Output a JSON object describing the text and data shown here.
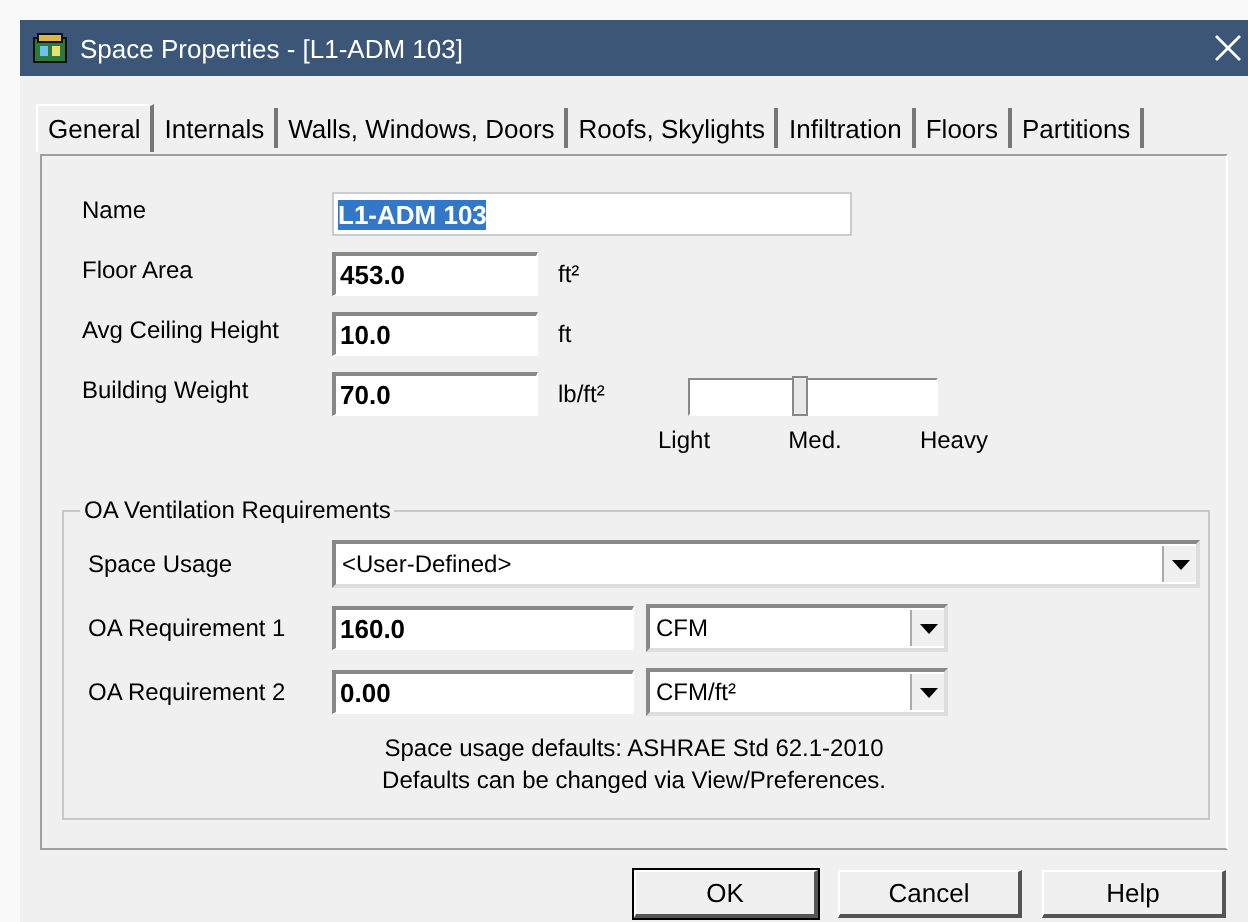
{
  "window": {
    "title": "Space Properties - [L1-ADM 103]"
  },
  "tabs": [
    {
      "label": "General",
      "selected": true
    },
    {
      "label": "Internals",
      "selected": false
    },
    {
      "label": "Walls, Windows, Doors",
      "selected": false
    },
    {
      "label": "Roofs, Skylights",
      "selected": false
    },
    {
      "label": "Infiltration",
      "selected": false
    },
    {
      "label": "Floors",
      "selected": false
    },
    {
      "label": "Partitions",
      "selected": false
    }
  ],
  "fields": [
    {
      "label": "Name",
      "value": "L1-ADM 103",
      "text_selected": true
    },
    {
      "label": "Floor Area",
      "value": "453.0",
      "unit": "ft²",
      "text_selected": false
    },
    {
      "label": "Avg Ceiling Height",
      "value": "10.0",
      "unit": "ft",
      "text_selected": false
    },
    {
      "label": "Building Weight",
      "value": "70.0",
      "unit": "lb/ft²",
      "text_selected": false
    }
  ],
  "weight_slider": {
    "level": 0.45,
    "labels": [
      "Light",
      "Med.",
      "Heavy"
    ]
  },
  "oa_ventilation": {
    "title": "OA Ventilation Requirements",
    "space_usage": {
      "label": "Space Usage",
      "value": "<User-Defined>"
    },
    "requirements": [
      {
        "label": "OA Requirement 1",
        "value": "160.0",
        "unit": "CFM"
      },
      {
        "label": "OA Requirement 2",
        "value": "0.00",
        "unit": "CFM/ft²"
      }
    ],
    "notes": [
      "Space usage defaults: ASHRAE Std 62.1-2010",
      "Defaults can be changed via View/Preferences."
    ]
  },
  "buttons": [
    {
      "label": "OK",
      "default": true
    },
    {
      "label": "Cancel",
      "default": false
    },
    {
      "label": "Help",
      "default": false
    }
  ]
}
